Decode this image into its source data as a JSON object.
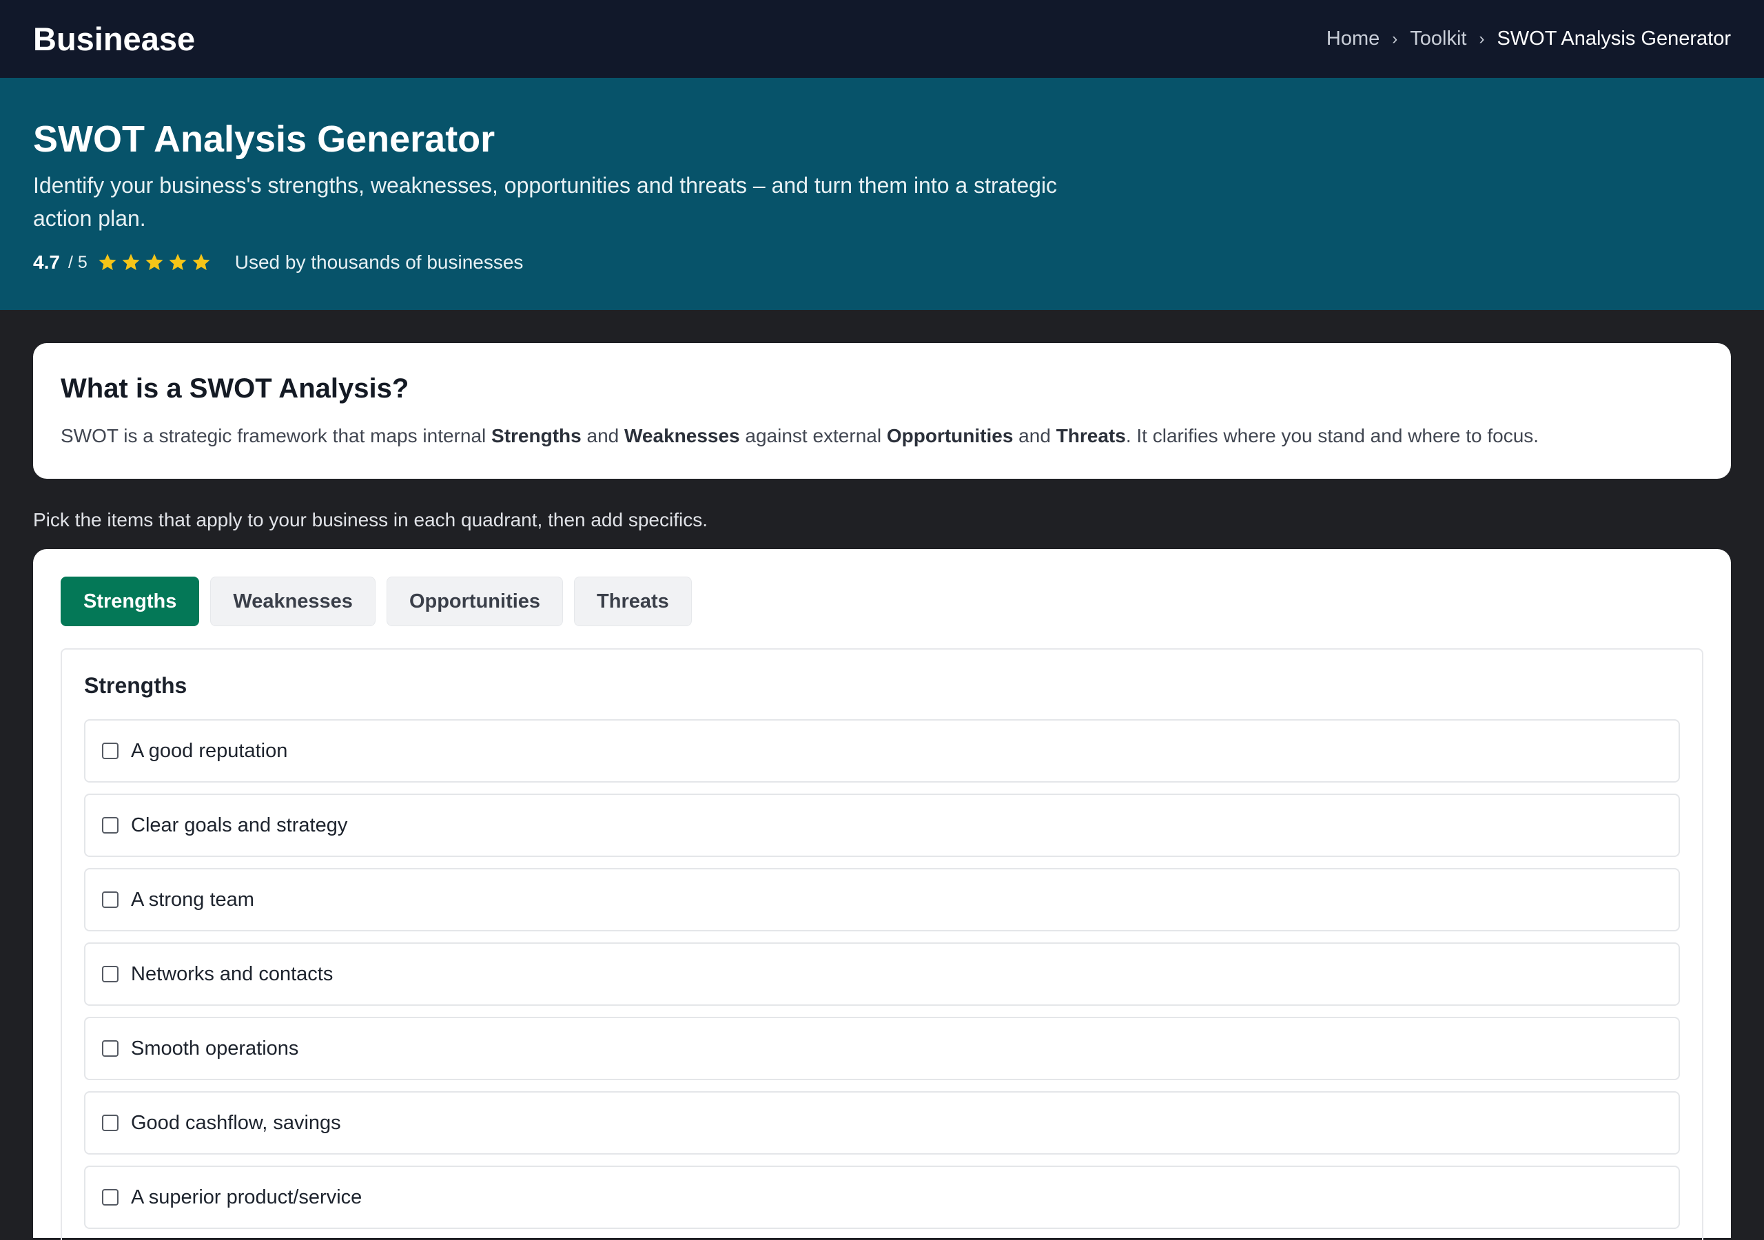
{
  "header": {
    "brand": "Businease",
    "breadcrumb": [
      {
        "label": "Home"
      },
      {
        "label": "Toolkit"
      },
      {
        "label": "SWOT Analysis Generator"
      }
    ]
  },
  "hero": {
    "title": "SWOT Analysis Generator",
    "subtitle": "Identify your business's strengths, weaknesses, opportunities and threats – and turn them into a strategic action plan.",
    "rating_score": "4.7",
    "rating_outof": "/ 5",
    "rating_stars": 5,
    "used_by": "Used by thousands of businesses",
    "star_color": "#f5c518"
  },
  "intro": {
    "heading": "What is a SWOT Analysis?",
    "text_1": "SWOT is a strategic framework that maps internal ",
    "bold_1": "Strengths",
    "text_2": " and ",
    "bold_2": "Weaknesses",
    "text_3": " against external ",
    "bold_3": "Opportunities",
    "text_4": " and ",
    "bold_4": "Threats",
    "text_5": ". It clarifies where you stand and where to focus."
  },
  "instruction": "Pick the items that apply to your business in each quadrant, then add specifics.",
  "tabs": [
    {
      "label": "Strengths",
      "active": true
    },
    {
      "label": "Weaknesses",
      "active": false
    },
    {
      "label": "Opportunities",
      "active": false
    },
    {
      "label": "Threats",
      "active": false
    }
  ],
  "quadrant": {
    "title": "Strengths",
    "options": [
      {
        "label": "A good reputation",
        "checked": false
      },
      {
        "label": "Clear goals and strategy",
        "checked": false
      },
      {
        "label": "A strong team",
        "checked": false
      },
      {
        "label": "Networks and contacts",
        "checked": false
      },
      {
        "label": "Smooth operations",
        "checked": false
      },
      {
        "label": "Good cashflow, savings",
        "checked": false
      },
      {
        "label": "A superior product/service",
        "checked": false
      }
    ]
  },
  "colors": {
    "topbar": "#11182a",
    "hero": "#07536a",
    "active_tab": "#047857",
    "page_bg": "#1f2024"
  }
}
